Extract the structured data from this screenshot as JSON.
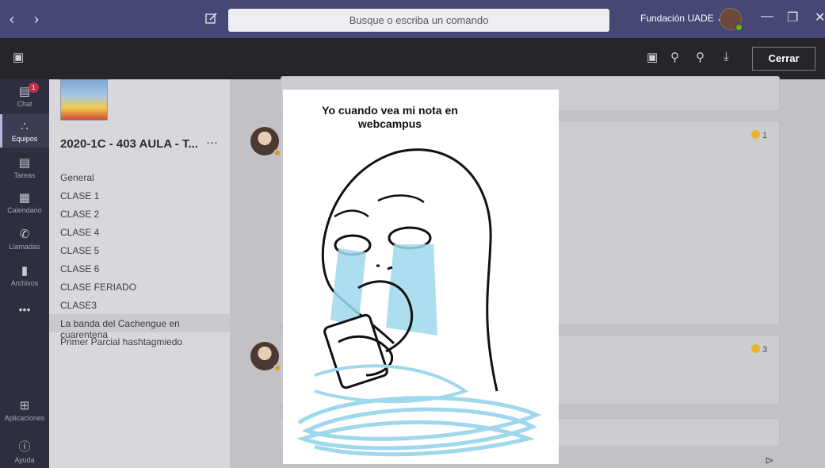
{
  "titlebar": {
    "search_placeholder": "Busque o escriba un comando",
    "org": "Fundación UADE ⌄"
  },
  "viewer": {
    "close_label": "Cerrar"
  },
  "rail": {
    "chat": {
      "label": "Chat",
      "badge": "1"
    },
    "teams": {
      "label": "Equipos"
    },
    "tasks": {
      "label": "Tareas"
    },
    "calendar": {
      "label": "Calendario"
    },
    "calls": {
      "label": "Llamadas"
    },
    "files": {
      "label": "Archivos"
    },
    "more": "•••",
    "apps": {
      "label": "Aplicaciones"
    },
    "help": {
      "label": "Ayuda"
    }
  },
  "team": {
    "name": "2020-1C - 403 AULA - T...",
    "more": "···",
    "channels": [
      "General",
      "CLASE 1",
      "CLASE 2",
      "CLASE 4",
      "CLASE 5",
      "CLASE 6",
      "CLASE FERIADO",
      "CLASE3",
      "La banda del Cachengue en cuarentena",
      "Primer Parcial hashtagmiedo"
    ]
  },
  "conversation": {
    "reaction1": "1",
    "reaction2": "3"
  },
  "meme": {
    "caption": "Yo cuando vea mi nota en webcampus"
  },
  "colors": {
    "titlebar": "#464775",
    "rail": "#2e2f3e",
    "tears": "#9fd8ec"
  }
}
